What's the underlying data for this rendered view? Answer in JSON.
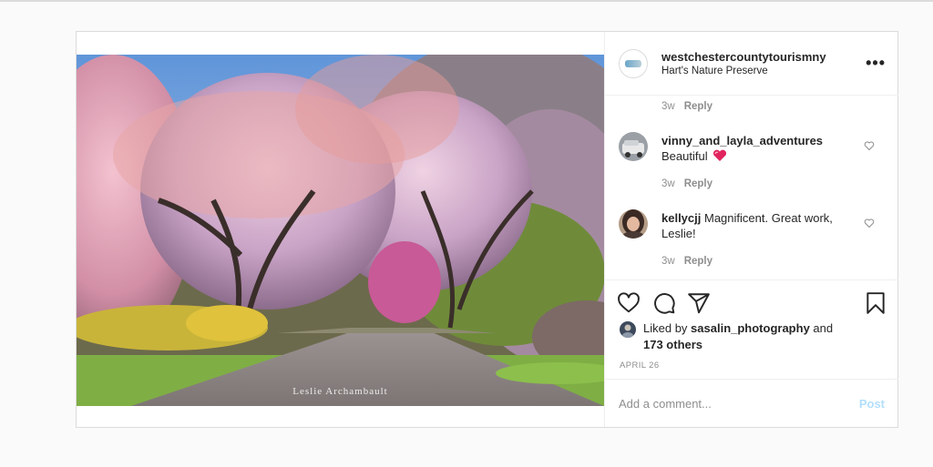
{
  "post": {
    "account": "westchestercountytourismny",
    "location": "Hart's Nature Preserve",
    "watermark": "Leslie Archambault",
    "more_icon": "more-horizontal-icon"
  },
  "comments": [
    {
      "time": "3w",
      "reply": "Reply"
    },
    {
      "user": "vinny_and_layla_adventures",
      "text": "Beautiful",
      "emoji": "heart-emoji",
      "time": "3w",
      "reply": "Reply"
    },
    {
      "user": "kellycjj",
      "text": "Magnificent. Great work, Leslie!",
      "time": "3w",
      "reply": "Reply"
    }
  ],
  "actions": {
    "icons": [
      "heart-icon",
      "comment-icon",
      "share-icon",
      "bookmark-icon"
    ]
  },
  "likes": {
    "prefix": "Liked by",
    "user": "sasalin_photography",
    "and": "and",
    "others": "173 others"
  },
  "date": "APRIL 26",
  "add_comment": {
    "placeholder": "Add a comment...",
    "post_label": "Post"
  },
  "colors": {
    "border": "#dbdbdb",
    "text": "#262626",
    "muted": "#8e8e8e",
    "post_disabled": "#b2dffc",
    "heart_emoji": "#e0245e"
  }
}
